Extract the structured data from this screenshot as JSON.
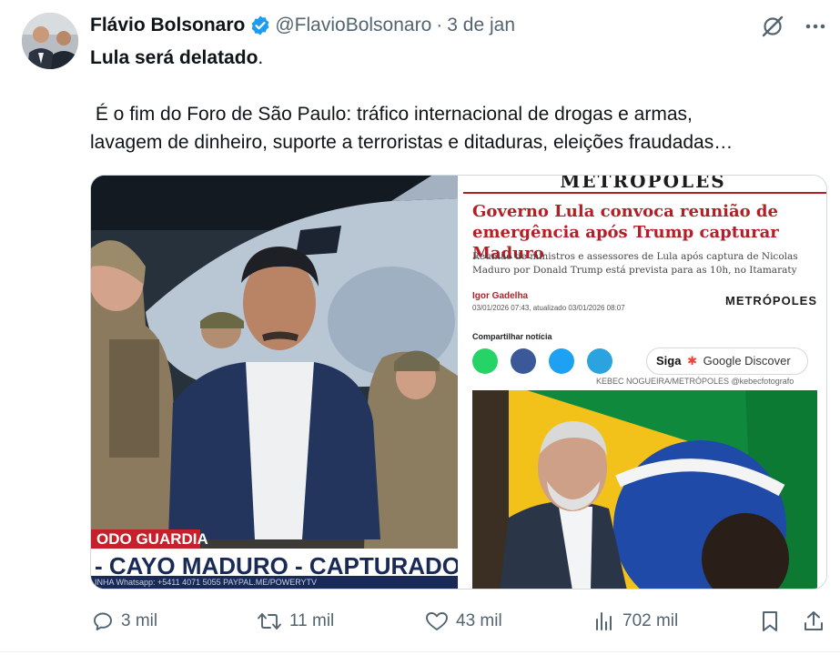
{
  "author": {
    "name": "Flávio Bolsonaro",
    "handle": "@FlavioBolsonaro",
    "separator": "·",
    "date": "3 de jan"
  },
  "tweet": {
    "line1_bold": "Lula será delatado",
    "line1_end": ".",
    "line2": " É o fim do Foro de São Paulo: tráfico internacional de drogas e armas,",
    "line3": "lavagem de dinheiro, suporte a terroristas e ditaduras, eleições fraudadas…"
  },
  "media_left": {
    "tag": "ODO GUARDIA",
    "headline": "- CAYO MADURO - CAPTURADO!",
    "ticker": "INHA  Whatsapp: +5411 4071 5055    PAYPAL.ME/POWERYTV"
  },
  "media_right": {
    "logo": "METRÓPOLES",
    "title": "Governo Lula convoca reunião de emergência após Trump capturar Maduro",
    "subtitle": "Reunião de ministros e assessores de Lula após captura de Nicolas Maduro por Donald Trump está prevista para as 10h, no Itamaraty",
    "author": "Igor Gadelha",
    "dates": "03/01/2026 07:43, atualizado 03/01/2026 08:07",
    "brand": "METRÓPOLES",
    "share_label": "Compartilhar notícia",
    "siga": "Siga",
    "google_discover": "Google Discover",
    "credit": "KEBEC NOGUEIRA/METRÓPOLES @kebecfotografo"
  },
  "actions": {
    "replies": "3 mil",
    "reposts": "11 mil",
    "likes": "43 mil",
    "views": "702 mil"
  },
  "colors": {
    "text": "#0f1419",
    "muted": "#536471",
    "verified": "#1d9bf0",
    "metropoles_red": "#b41e27"
  }
}
